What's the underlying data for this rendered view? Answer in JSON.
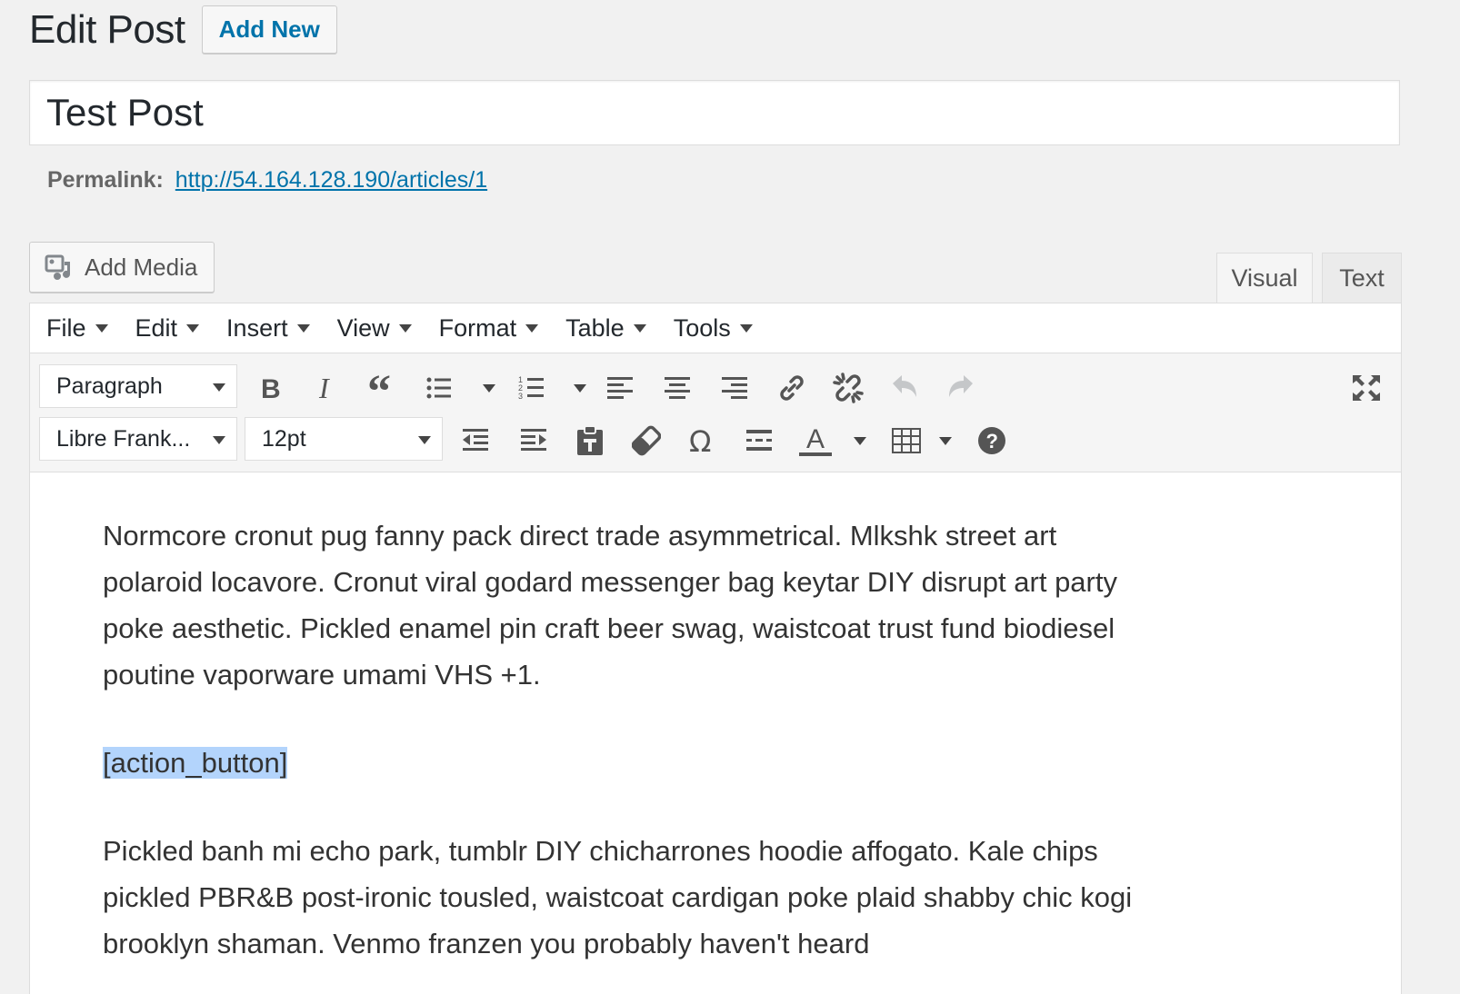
{
  "header": {
    "title": "Edit Post",
    "add_new": "Add New"
  },
  "post": {
    "title": "Test Post",
    "permalink_label": "Permalink:",
    "permalink_url": "http://54.164.128.190/articles/1"
  },
  "media": {
    "add_media": "Add Media"
  },
  "tabs": {
    "visual": "Visual",
    "text": "Text"
  },
  "menubar": [
    "File",
    "Edit",
    "Insert",
    "View",
    "Format",
    "Table",
    "Tools"
  ],
  "toolbar": {
    "block_format": "Paragraph",
    "font_family": "Libre Frank...",
    "font_size": "12pt",
    "icons_row1": [
      "bold-icon",
      "italic-icon",
      "blockquote-icon",
      "bullet-list-icon",
      "numbered-list-icon",
      "align-left-icon",
      "align-center-icon",
      "align-right-icon",
      "link-icon",
      "unlink-icon",
      "undo-icon",
      "redo-icon",
      "fullscreen-icon"
    ],
    "icons_row2": [
      "outdent-icon",
      "indent-icon",
      "paste-text-icon",
      "clear-formatting-icon",
      "special-character-icon",
      "read-more-icon",
      "text-color-icon",
      "table-icon",
      "help-icon"
    ]
  },
  "content": {
    "paragraph1": "Normcore cronut pug fanny pack direct trade asymmetrical. Mlkshk street art polaroid locavore. Cronut viral godard messenger bag keytar DIY disrupt art party poke aesthetic. Pickled enamel pin craft beer swag, waistcoat trust fund biodiesel poutine vaporware umami VHS +1.",
    "shortcode": "[action_button]",
    "paragraph2": "Pickled banh mi echo park, tumblr DIY chicharrones hoodie affogato. Kale chips pickled PBR&B post-ironic tousled, waistcoat cardigan poke plaid shabby chic kogi brooklyn shaman. Venmo franzen you probably haven't heard"
  },
  "colors": {
    "link": "#0073aa",
    "selection": "#b3d4fc",
    "text": "#23282d"
  }
}
